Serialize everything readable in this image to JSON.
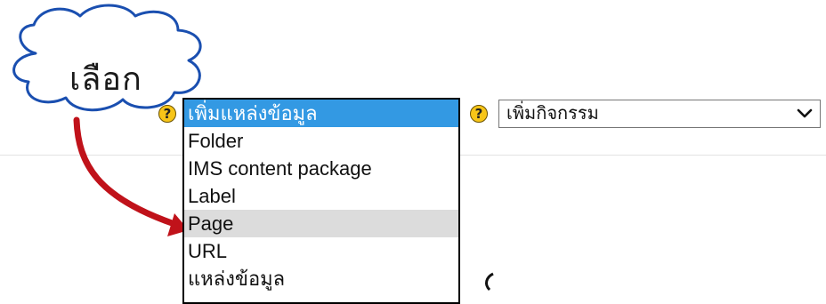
{
  "callout": {
    "text": "เลือก"
  },
  "resource_select": {
    "options": [
      {
        "label": "เพิ่มแหล่งข้อมูล"
      },
      {
        "label": "Folder"
      },
      {
        "label": "IMS content package"
      },
      {
        "label": "Label"
      },
      {
        "label": "Page"
      },
      {
        "label": "URL"
      },
      {
        "label": "แหล่งข้อมูล"
      }
    ]
  },
  "activity_select": {
    "value": "เพิ่มกิจกรรม"
  },
  "help_icon": {
    "glyph": "?"
  },
  "colors": {
    "selected": "#3399e3",
    "hover": "#dcdcdc",
    "arrow": "#c0121a",
    "help_bg": "#f7c518"
  }
}
